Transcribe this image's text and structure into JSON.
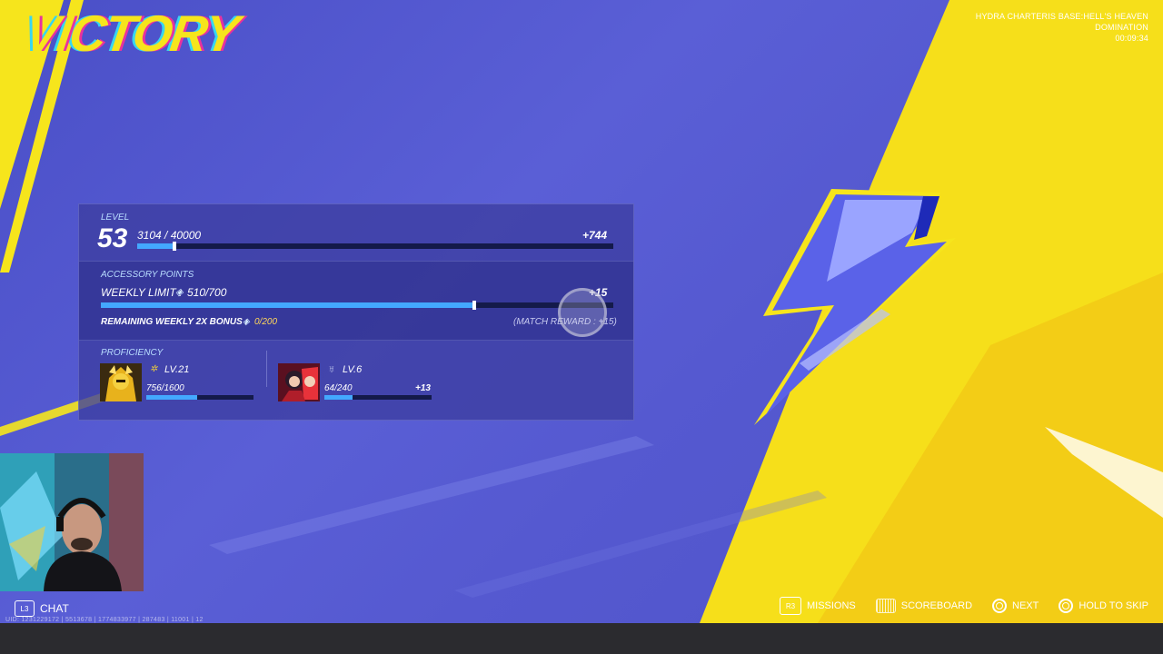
{
  "result": {
    "title": "VICTORY"
  },
  "match": {
    "map": "HYDRA CHARTERIS BASE:HELL'S HEAVEN",
    "mode": "DOMINATION",
    "time": "00:09:34"
  },
  "level": {
    "label": "LEVEL",
    "value": "53",
    "progress_text": "3104 / 40000",
    "progress": 0.0776,
    "gain": "+744"
  },
  "accessory": {
    "label": "ACCESSORY POINTS",
    "weekly_label": "WEEKLY LIMIT :",
    "weekly_value": "510/700",
    "weekly_progress": 0.7286,
    "gain": "+15",
    "bonus_label": "REMAINING WEEKLY 2X BONUS :",
    "bonus_value": "0/200",
    "match_reward": "(MATCH REWARD : +15)"
  },
  "proficiency": {
    "label": "PROFICIENCY",
    "heroes": [
      {
        "level": "LV.21",
        "progress_text": "756/1600",
        "progress": 0.4725,
        "gain": ""
      },
      {
        "level": "LV.6",
        "progress_text": "64/240",
        "progress": 0.2667,
        "gain": "+13"
      }
    ]
  },
  "chat": {
    "label": "CHAT",
    "button": "L3"
  },
  "uid_text": "UID: 1231229172 | 5513678 | 1774833977 | 287483 | 11001 | 12",
  "controls": [
    {
      "button": "R3",
      "label": "MISSIONS"
    },
    {
      "button": "touchpad",
      "label": "SCOREBOARD"
    },
    {
      "button": "circle",
      "label": "NEXT"
    },
    {
      "button": "circle",
      "label": "HOLD TO SKIP"
    }
  ],
  "colors": {
    "accent_yellow": "#f6e51c",
    "bg_blue": "#5559d0",
    "bar_blue": "#43a8ff"
  }
}
